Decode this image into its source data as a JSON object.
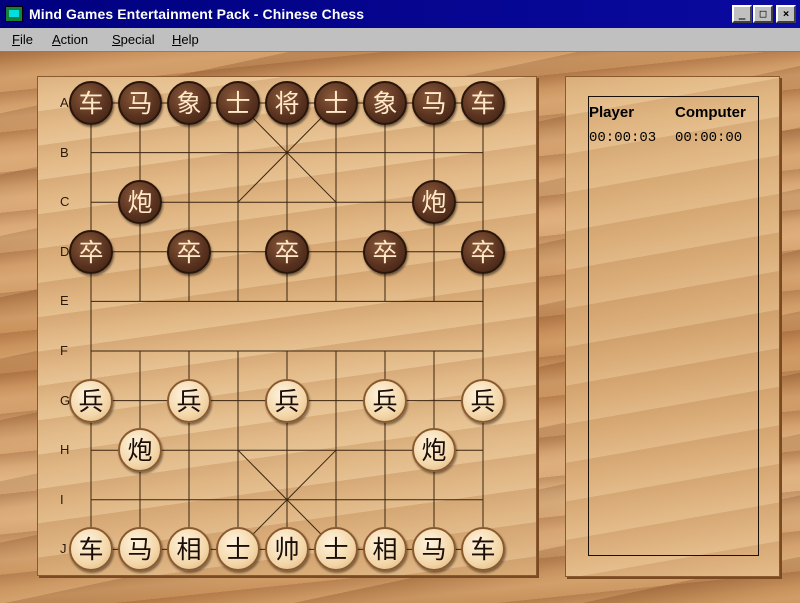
{
  "window": {
    "title": "Mind Games Entertainment Pack - Chinese Chess",
    "controls": [
      "_",
      "□",
      "×"
    ]
  },
  "menu": {
    "items": [
      "File",
      "Action",
      "Special",
      "Help"
    ]
  },
  "board": {
    "row_labels": [
      "A",
      "B",
      "C",
      "D",
      "E",
      "F",
      "G",
      "H",
      "I",
      "J"
    ],
    "pieces": [
      {
        "row": 0,
        "col": 0,
        "side": "black",
        "char": "车"
      },
      {
        "row": 0,
        "col": 1,
        "side": "black",
        "char": "马"
      },
      {
        "row": 0,
        "col": 2,
        "side": "black",
        "char": "象"
      },
      {
        "row": 0,
        "col": 3,
        "side": "black",
        "char": "士"
      },
      {
        "row": 0,
        "col": 4,
        "side": "black",
        "char": "将"
      },
      {
        "row": 0,
        "col": 5,
        "side": "black",
        "char": "士"
      },
      {
        "row": 0,
        "col": 6,
        "side": "black",
        "char": "象"
      },
      {
        "row": 0,
        "col": 7,
        "side": "black",
        "char": "马"
      },
      {
        "row": 0,
        "col": 8,
        "side": "black",
        "char": "车"
      },
      {
        "row": 2,
        "col": 1,
        "side": "black",
        "char": "炮"
      },
      {
        "row": 2,
        "col": 7,
        "side": "black",
        "char": "炮"
      },
      {
        "row": 3,
        "col": 0,
        "side": "black",
        "char": "卒"
      },
      {
        "row": 3,
        "col": 2,
        "side": "black",
        "char": "卒"
      },
      {
        "row": 3,
        "col": 4,
        "side": "black",
        "char": "卒"
      },
      {
        "row": 3,
        "col": 6,
        "side": "black",
        "char": "卒"
      },
      {
        "row": 3,
        "col": 8,
        "side": "black",
        "char": "卒"
      },
      {
        "row": 6,
        "col": 0,
        "side": "red",
        "char": "兵"
      },
      {
        "row": 6,
        "col": 2,
        "side": "red",
        "char": "兵"
      },
      {
        "row": 6,
        "col": 4,
        "side": "red",
        "char": "兵"
      },
      {
        "row": 6,
        "col": 6,
        "side": "red",
        "char": "兵"
      },
      {
        "row": 6,
        "col": 8,
        "side": "red",
        "char": "兵"
      },
      {
        "row": 7,
        "col": 1,
        "side": "red",
        "char": "炮"
      },
      {
        "row": 7,
        "col": 7,
        "side": "red",
        "char": "炮"
      },
      {
        "row": 9,
        "col": 0,
        "side": "red",
        "char": "车"
      },
      {
        "row": 9,
        "col": 1,
        "side": "red",
        "char": "马"
      },
      {
        "row": 9,
        "col": 2,
        "side": "red",
        "char": "相"
      },
      {
        "row": 9,
        "col": 3,
        "side": "red",
        "char": "士"
      },
      {
        "row": 9,
        "col": 4,
        "side": "red",
        "char": "帅"
      },
      {
        "row": 9,
        "col": 5,
        "side": "red",
        "char": "士"
      },
      {
        "row": 9,
        "col": 6,
        "side": "red",
        "char": "相"
      },
      {
        "row": 9,
        "col": 7,
        "side": "red",
        "char": "马"
      },
      {
        "row": 9,
        "col": 8,
        "side": "red",
        "char": "车"
      }
    ]
  },
  "status": {
    "player_label": "Player",
    "computer_label": "Computer",
    "player_time": "00:00:03",
    "computer_time": "00:00:00"
  },
  "colors": {
    "titlebar": "#00007e",
    "grid_line": "#3a2410"
  }
}
